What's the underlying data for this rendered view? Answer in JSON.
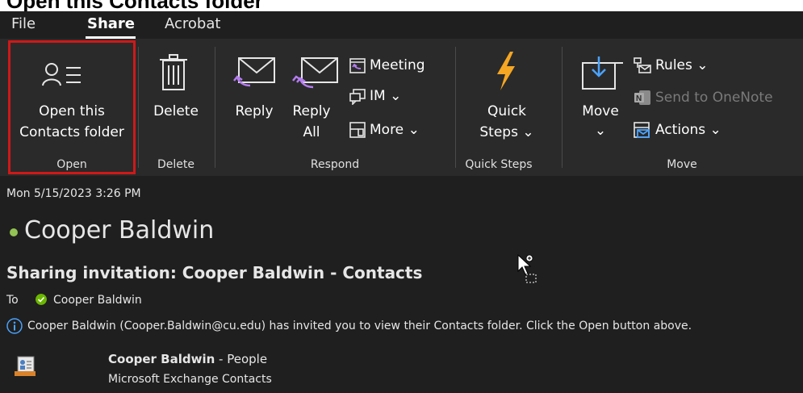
{
  "caption": {
    "text": "Open this Contacts folder"
  },
  "menu": {
    "items": [
      "File",
      "Share",
      "Acrobat"
    ],
    "active": "Share"
  },
  "ribbon": {
    "open_group": {
      "button_line1": "Open this",
      "button_line2": "Contacts folder",
      "label": "Open"
    },
    "delete_group": {
      "button": "Delete",
      "label": "Delete"
    },
    "respond_group": {
      "reply": "Reply",
      "reply_all_line1": "Reply",
      "reply_all_line2": "All",
      "meeting": "Meeting",
      "im": "IM",
      "more": "More",
      "label": "Respond"
    },
    "quicksteps_group": {
      "button_line1": "Quick",
      "button_line2": "Steps",
      "label": "Quick Steps"
    },
    "move_group": {
      "move": "Move",
      "rules": "Rules",
      "send_to_onenote": "Send to OneNote",
      "actions": "Actions",
      "label": "Move"
    },
    "dropdown_glyph": "⌄"
  },
  "message": {
    "date": "Mon 5/15/2023 3:26 PM",
    "sender": "Cooper Baldwin",
    "subject": "Sharing invitation: Cooper Baldwin - Contacts",
    "to_label": "To",
    "to_name": "Cooper Baldwin",
    "info": "Cooper Baldwin (Cooper.Baldwin@cu.edu) has invited you to view their Contacts folder.  Click the Open button above.",
    "attachment_title_bold": "Cooper Baldwin",
    "attachment_title_rest": " - People",
    "attachment_subtitle": "Microsoft Exchange Contacts"
  },
  "colors": {
    "accent_purple": "#b57cf0",
    "highlight_red": "#d01818",
    "presence_green": "#92c353",
    "info_blue": "#4aa3ff",
    "quicksteps_orange": "#f5a623"
  }
}
